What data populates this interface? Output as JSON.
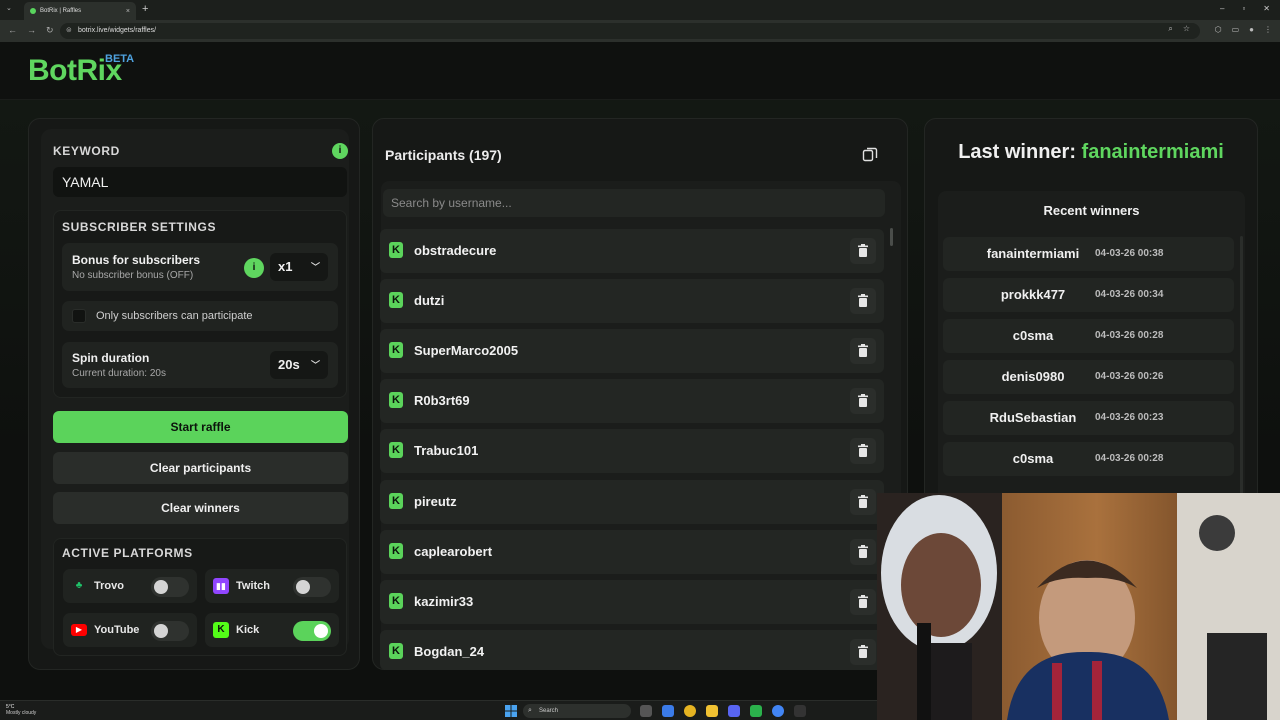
{
  "browser": {
    "tab_title": "BotRix | Raffles",
    "url": "botrix.live/widgets/raffles/",
    "tab_close": "×",
    "new_tab": "+"
  },
  "app": {
    "logo": "BotRix",
    "beta": "BETA"
  },
  "left": {
    "keyword_label": "KEYWORD",
    "keyword_value": "YAMAL",
    "subscriber_settings_label": "SUBSCRIBER SETTINGS",
    "bonus_title": "Bonus for subscribers",
    "bonus_sub": "No subscriber bonus (OFF)",
    "bonus_multiplier": "x1",
    "only_subs_label": "Only subscribers can participate",
    "spin_title": "Spin duration",
    "spin_sub": "Current duration: 20s",
    "spin_value": "20s",
    "start_button": "Start raffle",
    "clear_participants_button": "Clear participants",
    "clear_winners_button": "Clear winners",
    "active_platforms_label": "ACTIVE PLATFORMS",
    "platforms": [
      {
        "name": "Trovo",
        "enabled": false,
        "color": "#1fc46a"
      },
      {
        "name": "Twitch",
        "enabled": false,
        "color": "#9146ff"
      },
      {
        "name": "YouTube",
        "enabled": false,
        "color": "#ff0000"
      },
      {
        "name": "Kick",
        "enabled": true,
        "color": "#53fc18"
      }
    ]
  },
  "participants": {
    "title": "Participants (197)",
    "search_placeholder": "Search by username...",
    "list": [
      "obstradecure",
      "dutzi",
      "SuperMarco2005",
      "R0b3rt69",
      "Trabuc101",
      "pireutz",
      "caplearobert",
      "kazimir33",
      "Bogdan_24"
    ]
  },
  "winners": {
    "last_winner_label": "Last winner:",
    "last_winner_name": "fanaintermiami",
    "recent_title": "Recent winners",
    "list": [
      {
        "name": "fanaintermiami",
        "time": "04-03-26 00:38"
      },
      {
        "name": "prokkk477",
        "time": "04-03-26 00:34"
      },
      {
        "name": "c0sma",
        "time": "04-03-26 00:28"
      },
      {
        "name": "denis0980",
        "time": "04-03-26 00:26"
      },
      {
        "name": "RduSebastian",
        "time": "04-03-26 00:23"
      },
      {
        "name": "c0sma",
        "time": "04-03-26 00:28"
      }
    ]
  },
  "taskbar": {
    "temp": "5°C",
    "weather": "Mostly cloudy",
    "search": "Search"
  },
  "colors": {
    "accent": "#5bd35b",
    "beta": "#4fa3e0",
    "background": "#0d0f0d"
  }
}
